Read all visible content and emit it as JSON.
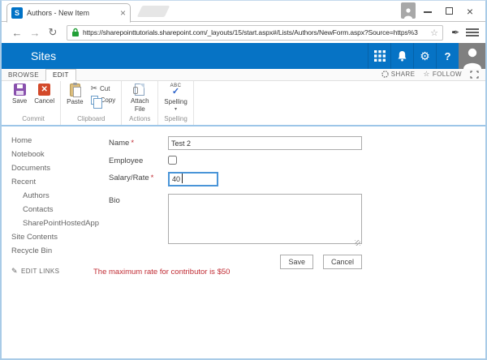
{
  "window": {
    "tab_title": "Authors - New Item",
    "favicon_glyph": "S",
    "tab_close": "×",
    "close_glyph": "×"
  },
  "browser": {
    "url": "https://sharepointtutorials.sharepoint.com/_layouts/15/start.aspx#/Lists/Authors/NewForm.aspx?Source=https%3",
    "back": "←",
    "forward": "→",
    "reload": "↻",
    "bookmark_star": "☆"
  },
  "suite_bar": {
    "title": "Sites",
    "help": "?",
    "gear": "⚙"
  },
  "ribbon": {
    "tabs": {
      "browse": "BROWSE",
      "edit": "EDIT"
    },
    "share": "SHARE",
    "follow": "FOLLOW",
    "follow_star": "☆",
    "groups": {
      "commit": {
        "label": "Commit",
        "save": "Save",
        "cancel": "Cancel",
        "cancel_x": "✕"
      },
      "clipboard": {
        "label": "Clipboard",
        "paste": "Paste",
        "cut": "Cut",
        "cut_scissors": "✂",
        "copy": "Copy"
      },
      "actions": {
        "label": "Actions",
        "attach": "Attach File"
      },
      "spelling": {
        "label": "Spelling",
        "spelling": "Spelling",
        "abc": "ABC",
        "check": "✓",
        "arrow": "▾"
      }
    }
  },
  "nav": {
    "items": [
      {
        "label": "Home"
      },
      {
        "label": "Notebook"
      },
      {
        "label": "Documents"
      },
      {
        "label": "Recent"
      },
      {
        "label": "Authors"
      },
      {
        "label": "Contacts"
      },
      {
        "label": "SharePointHostedApp"
      },
      {
        "label": "Site Contents"
      },
      {
        "label": "Recycle Bin"
      }
    ],
    "edit_links": "EDIT LINKS",
    "pencil": "✎"
  },
  "form": {
    "required_marker": "*",
    "fields": {
      "name": {
        "label": "Name",
        "value": "Test 2"
      },
      "employee": {
        "label": "Employee",
        "checked": false
      },
      "salary": {
        "label": "Salary/Rate",
        "value": "40"
      },
      "bio": {
        "label": "Bio",
        "value": ""
      }
    },
    "save_label": "Save",
    "cancel_label": "Cancel",
    "error": "The maximum rate for contributor is $50"
  },
  "colors": {
    "suite_bar_blue": "#0673c5",
    "favicon_blue": "#0072c6",
    "frame_blue": "#a9cbe7",
    "ribbon_border_blue": "#9dc6e8",
    "error_red": "#c02b33",
    "save_icon_purple": "#8950ad",
    "cancel_icon_red": "#d3492a",
    "focused_input_blue": "#4a95d8",
    "lock_green": "#23a038",
    "spelling_check_blue": "#2a61c9"
  }
}
